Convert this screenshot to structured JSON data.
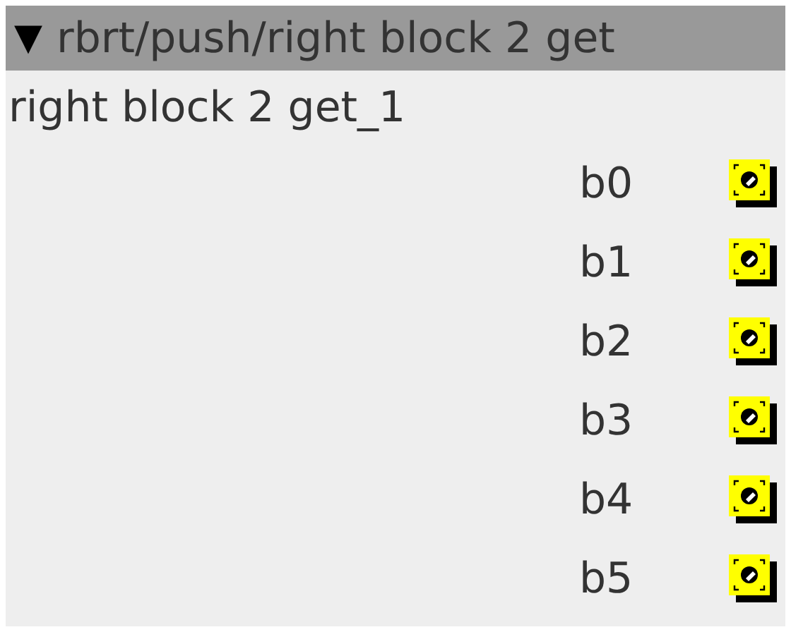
{
  "header": {
    "toggle": "▼",
    "expanded": true,
    "title": "rbrt/push/right block 2 get"
  },
  "block": {
    "name": "right block 2 get_1",
    "ports": [
      {
        "label": "b0"
      },
      {
        "label": "b1"
      },
      {
        "label": "b2"
      },
      {
        "label": "b3"
      },
      {
        "label": "b4"
      },
      {
        "label": "b5"
      }
    ]
  }
}
